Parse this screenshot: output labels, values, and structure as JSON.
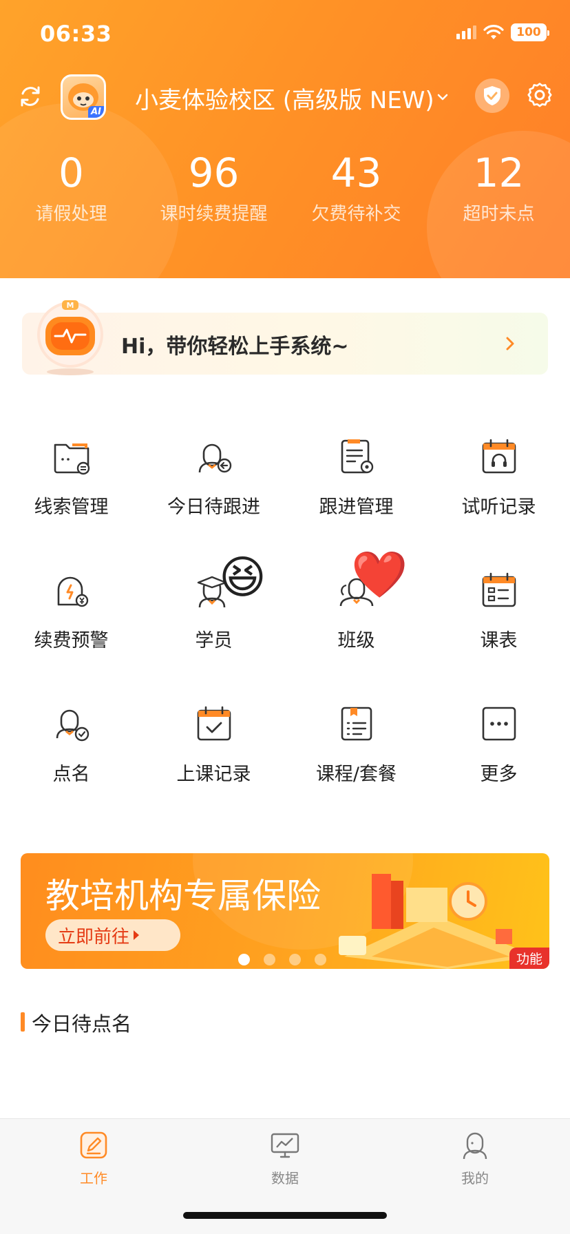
{
  "status_bar": {
    "time": "06:33",
    "battery": "100"
  },
  "header": {
    "campus_title": "小麦体验校区 (高级版 NEW)",
    "ai_badge": "AI",
    "stats": [
      {
        "value": "0",
        "label": "请假处理"
      },
      {
        "value": "96",
        "label": "课时续费提醒"
      },
      {
        "value": "43",
        "label": "欠费待补交"
      },
      {
        "value": "12",
        "label": "超时未点"
      }
    ]
  },
  "guide": {
    "text": "Hi，带你轻松上手系统~"
  },
  "grid": {
    "items": [
      {
        "label": "线索管理",
        "icon": "folder-icon"
      },
      {
        "label": "今日待跟进",
        "icon": "person-return-icon"
      },
      {
        "label": "跟进管理",
        "icon": "document-gear-icon"
      },
      {
        "label": "试听记录",
        "icon": "calendar-headphones-icon"
      },
      {
        "label": "续费预警",
        "icon": "bell-yen-icon"
      },
      {
        "label": "学员",
        "icon": "graduate-icon"
      },
      {
        "label": "班级",
        "icon": "group-icon"
      },
      {
        "label": "课表",
        "icon": "schedule-icon"
      },
      {
        "label": "点名",
        "icon": "person-check-icon"
      },
      {
        "label": "上课记录",
        "icon": "calendar-check-icon"
      },
      {
        "label": "课程/套餐",
        "icon": "course-list-icon"
      },
      {
        "label": "更多",
        "icon": "more-icon"
      }
    ],
    "emojis": {
      "student": "😆",
      "class": "❤️"
    }
  },
  "promo": {
    "title": "教培机构专属保险",
    "button": "立即前往",
    "tag": "功能",
    "slides": 4,
    "active_slide": 1
  },
  "section": {
    "title": "今日待点名"
  },
  "tabbar": {
    "active_color": "#ff8a26",
    "tabs": [
      {
        "label": "工作",
        "icon": "edit-icon",
        "active": true
      },
      {
        "label": "数据",
        "icon": "monitor-chart-icon",
        "active": false
      },
      {
        "label": "我的",
        "icon": "profile-icon",
        "active": false
      }
    ]
  }
}
